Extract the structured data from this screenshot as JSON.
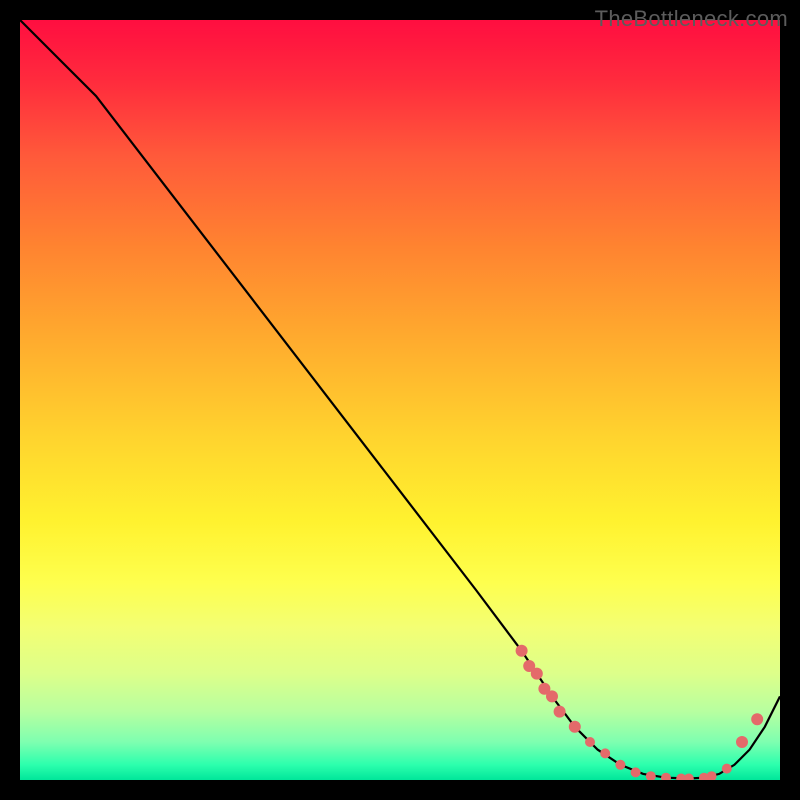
{
  "watermark": "TheBottleneck.com",
  "colors": {
    "curve": "#000000",
    "marker": "#e46a6a",
    "background_top": "#ff0e40",
    "background_bottom": "#00e69a",
    "frame": "#000000"
  },
  "chart_data": {
    "type": "line",
    "title": "",
    "xlabel": "",
    "ylabel": "",
    "xlim": [
      0,
      100
    ],
    "ylim": [
      0,
      100
    ],
    "grid": false,
    "legend": false,
    "series": [
      {
        "name": "bottleneck-curve",
        "x": [
          0,
          6,
          10,
          20,
          30,
          40,
          50,
          60,
          66,
          70,
          73,
          76,
          79,
          82,
          85,
          88,
          90,
          92,
          94,
          96,
          98,
          100
        ],
        "y": [
          100,
          94,
          90,
          77,
          64,
          51,
          38,
          25,
          17,
          11,
          7,
          4,
          2,
          0.8,
          0.3,
          0.2,
          0.3,
          0.8,
          2,
          4,
          7,
          11
        ]
      }
    ],
    "markers": {
      "name": "highlight-dots",
      "x": [
        66,
        67,
        68,
        69,
        70,
        71,
        73,
        75,
        77,
        79,
        81,
        83,
        85,
        87,
        88,
        90,
        91,
        93,
        95,
        97
      ],
      "y": [
        17,
        15,
        14,
        12,
        11,
        9,
        7,
        5,
        3.5,
        2,
        1,
        0.5,
        0.3,
        0.2,
        0.2,
        0.3,
        0.5,
        1.5,
        5,
        8
      ],
      "r": [
        6,
        6,
        6,
        6,
        6,
        6,
        6,
        5,
        5,
        5,
        5,
        5,
        5,
        5,
        5,
        5,
        5,
        5,
        6,
        6
      ]
    }
  }
}
